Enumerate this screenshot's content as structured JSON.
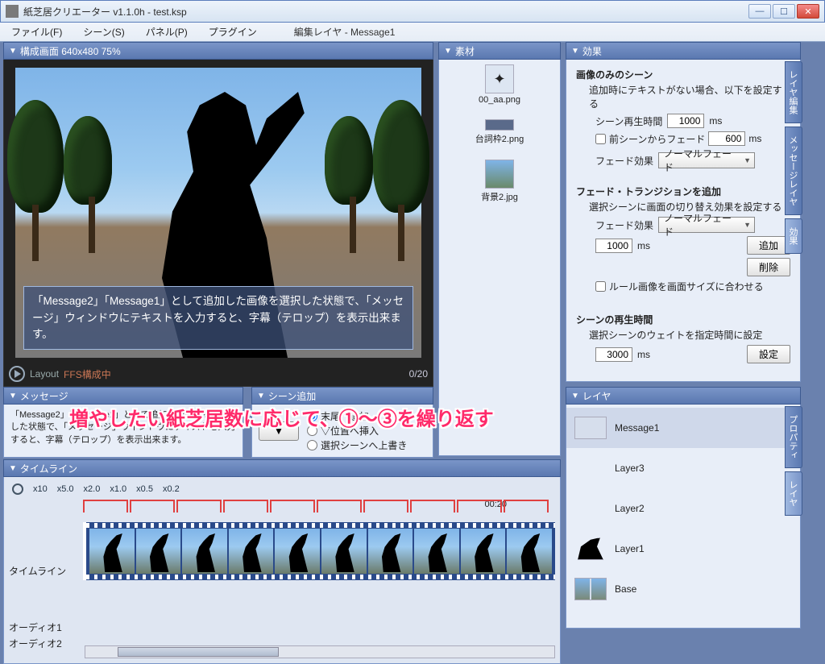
{
  "title": "紙芝居クリエーター v1.1.0h - test.ksp",
  "menubar": {
    "file": "ファイル(F)",
    "scene": "シーン(S)",
    "panel": "パネル(P)",
    "plugin": "プラグイン",
    "editlayer": "編集レイヤ - Message1"
  },
  "preview": {
    "header": "構成画面  640x480 75%",
    "message": "「Message2」「Message1」として追加した画像を選択した状態で、「メッセージ」ウィンドウにテキストを入力すると、字幕（テロップ）を表示出来ます。",
    "layout_label": "Layout",
    "ffs_label": "FFS構成中",
    "counter": "0/20"
  },
  "message_panel": {
    "header": "メッセージ",
    "text": "「Message2」「Message1」として追加した画像を選択した状態で、「メッセージ」ウィンドウにテキストを入力すると、字幕（テロップ）を表示出来ます。"
  },
  "sceneadd": {
    "header": "シーン追加",
    "options": [
      "末尾へ追加",
      "▽位置へ挿入",
      "選択シーンへ上書き"
    ],
    "selected": 0
  },
  "materials": {
    "header": "素材",
    "items": [
      {
        "name": "00_aa.png"
      },
      {
        "name": "台詞枠2.png"
      },
      {
        "name": "背景2.jpg"
      }
    ]
  },
  "effects": {
    "header": "効果",
    "sec1_title": "画像のみのシーン",
    "sec1_desc": "追加時にテキストがない場合、以下を設定する",
    "scene_play_label": "シーン再生時間",
    "scene_play_value": "1000",
    "ms": "ms",
    "prev_fade_label": "前シーンからフェード",
    "prev_fade_value": "600",
    "fade_effect_label": "フェード効果",
    "fade_effect_value": "ノーマルフェード",
    "sec2_title": "フェード・トランジションを追加",
    "sec2_desc": "選択シーンに画面の切り替え効果を設定する",
    "trans_time_value": "1000",
    "add_btn": "追加",
    "del_btn": "削除",
    "rule_label": "ルール画像を画面サイズに合わせる",
    "sec3_title": "シーンの再生時間",
    "sec3_desc": "選択シーンのウェイトを指定時間に設定",
    "wait_value": "3000",
    "set_btn": "設定"
  },
  "layers": {
    "header": "レイヤ",
    "items": [
      "Message1",
      "Layer3",
      "Layer2",
      "Layer1",
      "Base"
    ],
    "selected": 0
  },
  "side_tabs_right1": [
    "レイヤ編集",
    "メッセージレイヤ",
    "効果"
  ],
  "side_tabs_right2": [
    "プロパティ",
    "レイヤ"
  ],
  "timeline": {
    "header": "タイムライン",
    "zooms": [
      "x10",
      "x5.0",
      "x2.0",
      "x1.0",
      "x0.5",
      "x0.2"
    ],
    "timestamp": "00:20",
    "track_timeline": "タイムライン",
    "track_audio1": "オーディオ1",
    "track_audio2": "オーディオ2",
    "frame_count": 10
  },
  "annotation": "増やしたい紙芝居数に応じて、①～③を繰り返す"
}
